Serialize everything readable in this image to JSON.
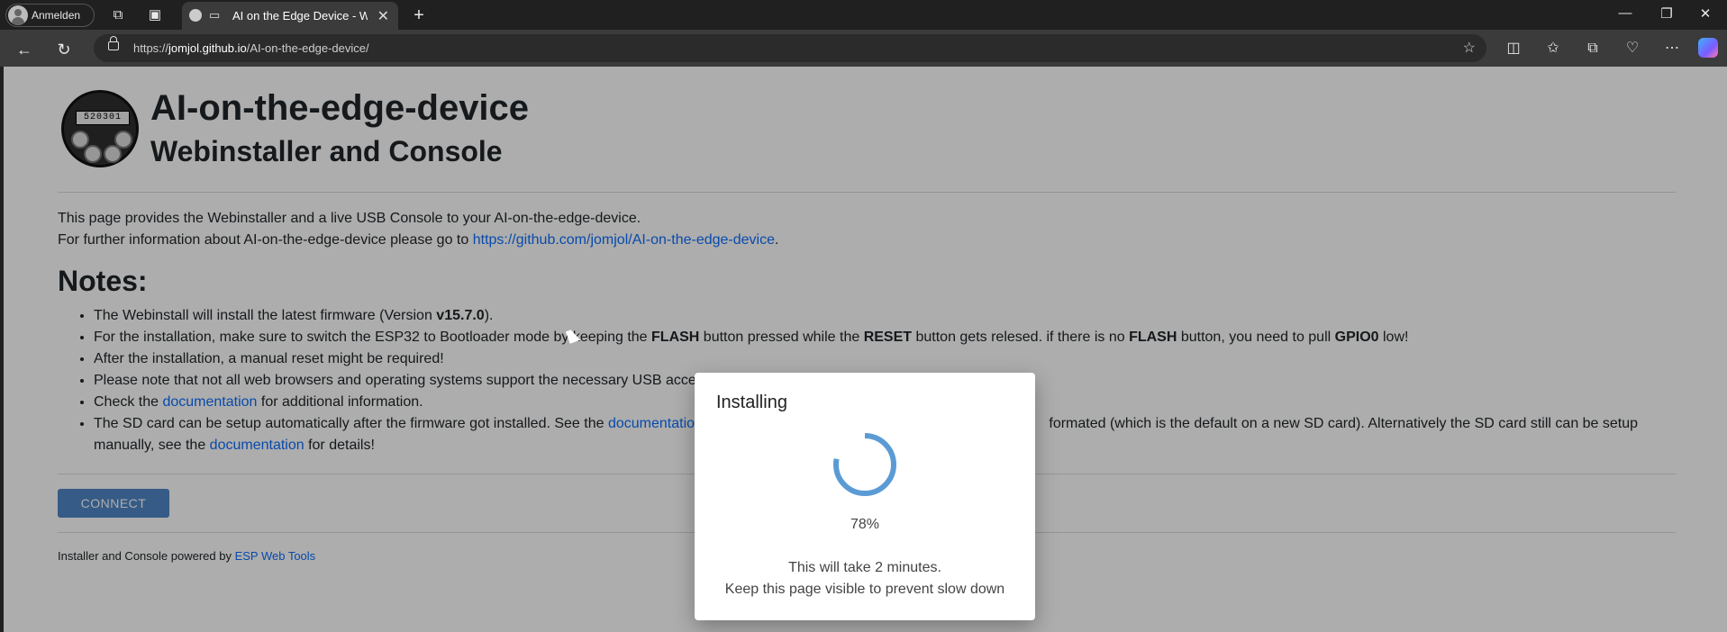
{
  "browser": {
    "profile_label": "Anmelden",
    "tab_title": "AI on the Edge Device - Web",
    "url_prefix": "https://",
    "url_host": "jomjol.github.io",
    "url_path": "/AI-on-the-edge-device/"
  },
  "page": {
    "logo_digits": "520301",
    "title": "AI-on-the-edge-device",
    "subtitle": "Webinstaller and Console",
    "intro_line1": "This page provides the Webinstaller and a live USB Console to your AI-on-the-edge-device.",
    "intro_line2_prefix": "For further information about AI-on-the-edge-device please go to ",
    "intro_link": "https://github.com/jomjol/AI-on-the-edge-device",
    "intro_line2_suffix": ".",
    "notes_heading": "Notes:",
    "notes": {
      "n1_a": "The Webinstall will install the latest firmware (Version ",
      "n1_b": "v15.7.0",
      "n1_c": ").",
      "n2_a": "For the installation, make sure to switch the ESP32 to Bootloader mode by keeping the ",
      "n2_b": "FLASH",
      "n2_c": " button pressed while the ",
      "n2_d": "RESET",
      "n2_e": " button gets relesed. if there is no ",
      "n2_f": "FLASH",
      "n2_g": " button, you need to pull ",
      "n2_h": "GPIO0",
      "n2_i": " low!",
      "n3": "After the installation, a manual reset might be required!",
      "n4": "Please note that not all web browsers and operating systems support the necessary USB access",
      "n5_a": "Check the ",
      "n5_link": "documentation",
      "n5_b": " for additional information.",
      "n6_a": "The SD card can be setup automatically after the firmware got installed. See the ",
      "n6_link": "documentation",
      "n6_b": " formated (which is the default on a new SD card). Alternatively the SD card still can be setup",
      "n6_c": "manually, see the ",
      "n6_link2": "documentation",
      "n6_d": " for details!"
    },
    "connect_button": "CONNECT",
    "footer_prefix": "Installer and Console powered by ",
    "footer_link": "ESP Web Tools"
  },
  "dialog": {
    "title": "Installing",
    "progress": 0.78,
    "progress_text": "78%",
    "message_line1": "This will take 2 minutes.",
    "message_line2": "Keep this page visible to prevent slow down"
  },
  "colors": {
    "accent": "#4f86c6",
    "link": "#0d6efd",
    "spinner": "#5b9bd5"
  }
}
